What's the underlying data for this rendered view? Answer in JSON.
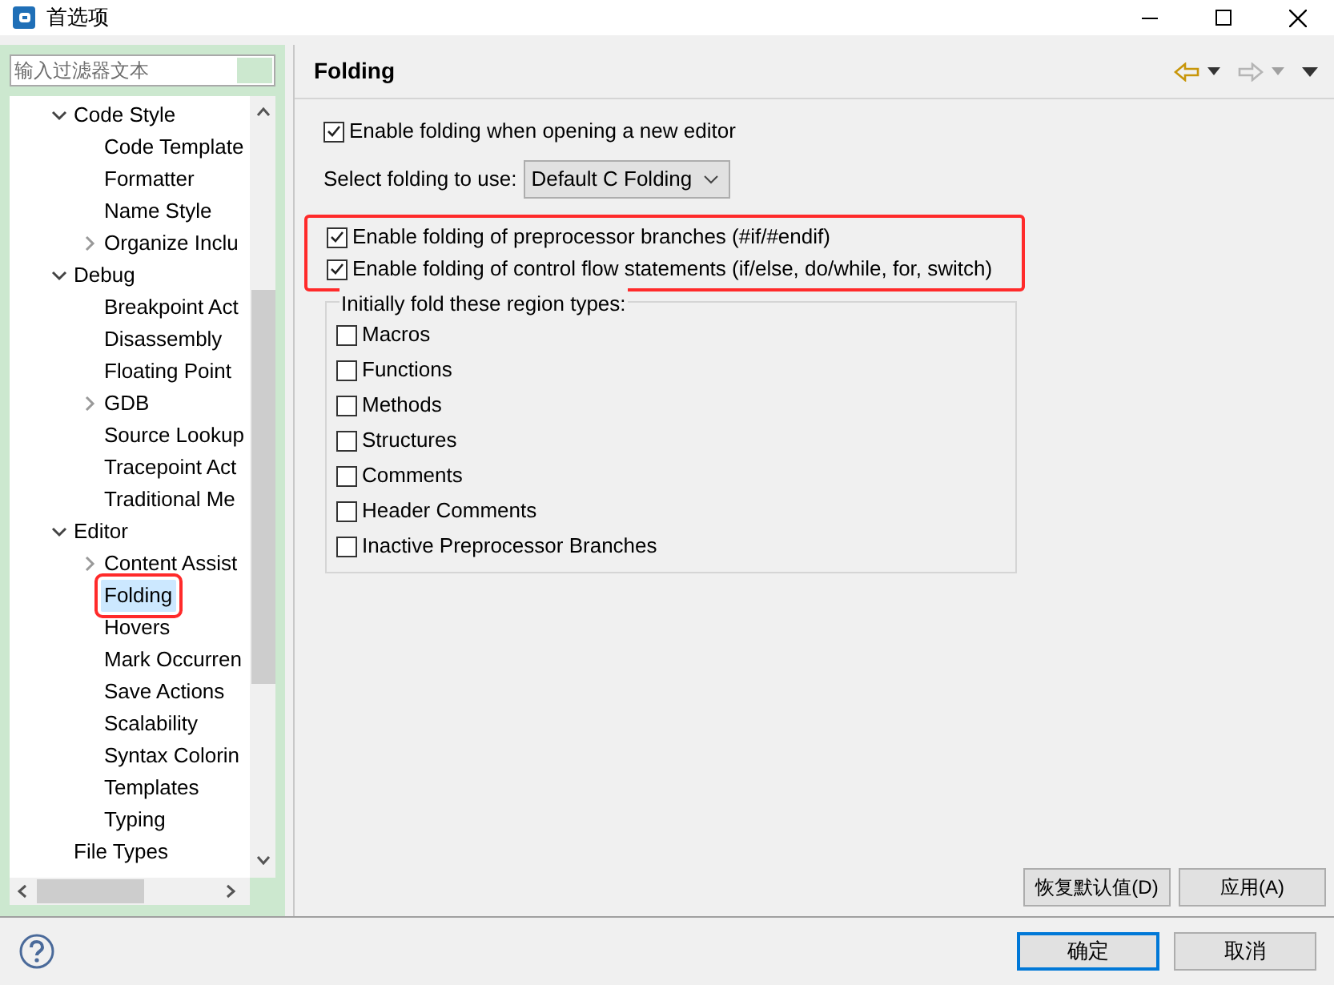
{
  "window": {
    "title": "首选项"
  },
  "filter": {
    "placeholder": "输入过滤器文本"
  },
  "tree": [
    {
      "label": "Code Style",
      "expanded": true,
      "selected": false,
      "highlighted": false,
      "children": [
        {
          "label": "Code Template",
          "selected": false,
          "highlighted": false
        },
        {
          "label": "Formatter",
          "selected": false,
          "highlighted": false
        },
        {
          "label": "Name Style",
          "selected": false,
          "highlighted": false
        },
        {
          "label": "Organize Inclu",
          "expanded": false,
          "selected": false,
          "highlighted": false
        }
      ]
    },
    {
      "label": "Debug",
      "expanded": true,
      "selected": false,
      "highlighted": false,
      "children": [
        {
          "label": "Breakpoint Act",
          "selected": false,
          "highlighted": false
        },
        {
          "label": "Disassembly",
          "selected": false,
          "highlighted": false
        },
        {
          "label": "Floating Point",
          "selected": false,
          "highlighted": false
        },
        {
          "label": "GDB",
          "expanded": false,
          "selected": false,
          "highlighted": false
        },
        {
          "label": "Source Lookup",
          "selected": false,
          "highlighted": false
        },
        {
          "label": "Tracepoint Act",
          "selected": false,
          "highlighted": false
        },
        {
          "label": "Traditional Me",
          "selected": false,
          "highlighted": false
        }
      ]
    },
    {
      "label": "Editor",
      "expanded": true,
      "selected": false,
      "highlighted": false,
      "children": [
        {
          "label": "Content Assist",
          "expanded": false,
          "selected": false,
          "highlighted": false
        },
        {
          "label": "Folding",
          "selected": true,
          "highlighted": true
        },
        {
          "label": "Hovers",
          "selected": false,
          "highlighted": false
        },
        {
          "label": "Mark Occurren",
          "selected": false,
          "highlighted": false
        },
        {
          "label": "Save Actions",
          "selected": false,
          "highlighted": false
        },
        {
          "label": "Scalability",
          "selected": false,
          "highlighted": false
        },
        {
          "label": "Syntax Colorin",
          "selected": false,
          "highlighted": false
        },
        {
          "label": "Templates",
          "selected": false,
          "highlighted": false
        },
        {
          "label": "Typing",
          "selected": false,
          "highlighted": false
        }
      ]
    },
    {
      "label": "File Types",
      "selected": false,
      "highlighted": false
    }
  ],
  "page": {
    "title": "Folding",
    "nav": {
      "back_enabled": true,
      "forward_enabled": false
    },
    "enable_on_open": {
      "label": "Enable folding when opening a new editor",
      "checked": true
    },
    "select": {
      "label": "Select folding to use:",
      "value": "Default C Folding"
    },
    "highlighted_options": [
      {
        "label": "Enable folding of preprocessor branches (#if/#endif)",
        "checked": true
      },
      {
        "label": "Enable folding of control flow statements (if/else, do/while, for, switch)",
        "checked": true
      }
    ],
    "region_group": {
      "title": "Initially fold these region types:",
      "items": [
        {
          "label": "Macros",
          "checked": false
        },
        {
          "label": "Functions",
          "checked": false
        },
        {
          "label": "Methods",
          "checked": false
        },
        {
          "label": "Structures",
          "checked": false
        },
        {
          "label": "Comments",
          "checked": false
        },
        {
          "label": "Header Comments",
          "checked": false
        },
        {
          "label": "Inactive Preprocessor Branches",
          "checked": false
        }
      ]
    },
    "buttons": [
      "恢复默认值(D)",
      "应用(A)"
    ]
  },
  "footer_buttons": [
    {
      "label": "确定",
      "default": true
    },
    {
      "label": "取消",
      "default": false
    }
  ]
}
